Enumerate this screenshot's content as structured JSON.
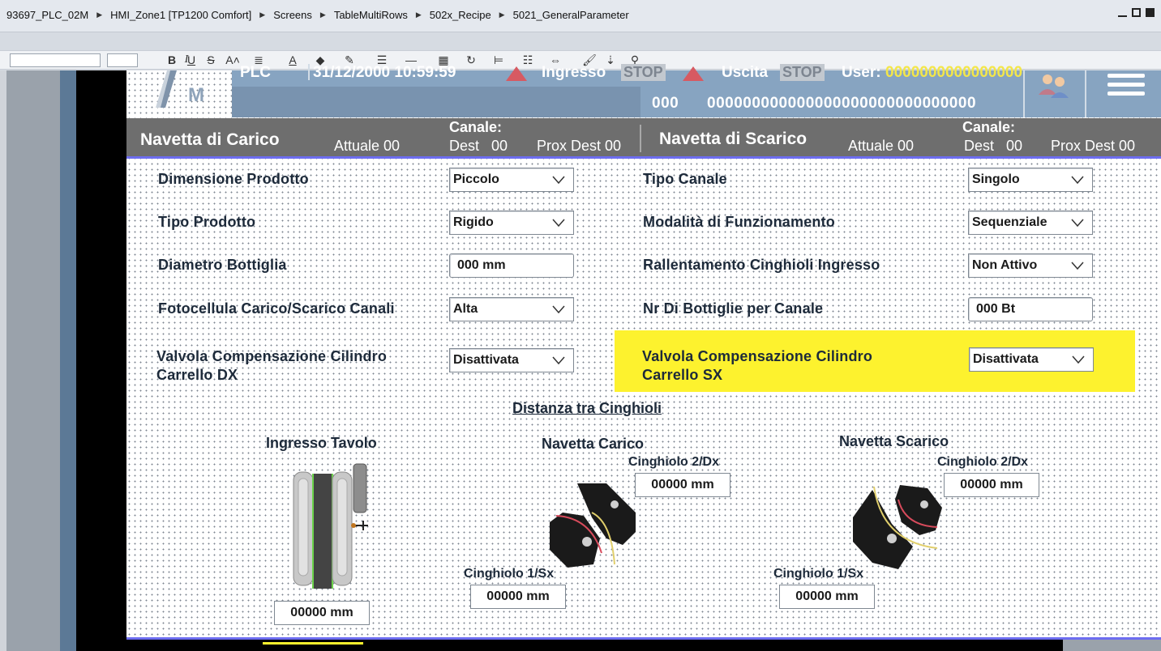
{
  "breadcrumb": {
    "items": [
      "93697_PLC_02M",
      "HMI_Zone1 [TP1200 Comfort]",
      "Screens",
      "TableMultiRows",
      "502x_Recipe",
      "5021_GeneralParameter"
    ]
  },
  "toolbar": {
    "bold": "B",
    "italic": "I",
    "underline": "U",
    "strike": "S"
  },
  "header": {
    "plc_label": "PLC",
    "datetime": "31/12/2000 10:59:59",
    "ingresso_label": "Ingresso",
    "ingresso_stop": "STOP",
    "uscita_label": "Uscita",
    "uscita_stop": "STOP",
    "user_label": "User:",
    "user_value": "0000000000000000",
    "code_short": "000",
    "code_long": "000000000000000000000000000000"
  },
  "band": {
    "carico_title": "Navetta di Carico",
    "carico_attuale": "Attuale 00",
    "carico_canale": "Canale:",
    "carico_dest": "Dest",
    "carico_dest_val": "00",
    "carico_prox": "Prox Dest 00",
    "scarico_title": "Navetta di Scarico",
    "scarico_attuale": "Attuale 00",
    "scarico_canale": "Canale:",
    "scarico_dest": "Dest",
    "scarico_dest_val": "00",
    "scarico_prox": "Prox Dest 00"
  },
  "form": {
    "dimensione_label": "Dimensione Prodotto",
    "dimensione_value": "Piccolo",
    "tipo_prodotto_label": "Tipo Prodotto",
    "tipo_prodotto_value": "Rigido",
    "diametro_label": "Diametro Bottiglia",
    "diametro_value": "000 mm",
    "fotocellula_label": "Fotocellula Carico/Scarico Canali",
    "fotocellula_value": "Alta",
    "valvola_dx_label_1": "Valvola Compensazione Cilindro",
    "valvola_dx_label_2": "Carrello DX",
    "valvola_dx_value": "Disattivata",
    "tipo_canale_label": "Tipo Canale",
    "tipo_canale_value": "Singolo",
    "modalita_label": "Modalità di Funzionamento",
    "modalita_value": "Sequenziale",
    "rallentamento_label": "Rallentamento Cinghioli Ingresso",
    "rallentamento_value": "Non Attivo",
    "nr_bottiglie_label": "Nr Di Bottiglie per Canale",
    "nr_bottiglie_value": "000 Bt",
    "valvola_sx_label_1": "Valvola Compensazione Cilindro",
    "valvola_sx_label_2": "Carrello SX",
    "valvola_sx_value": "Disattivata"
  },
  "distanza": {
    "title": "Distanza tra Cinghioli",
    "ingresso_title": "Ingresso Tavolo",
    "ingresso_value": "00000 mm",
    "carico_title": "Navetta Carico",
    "carico_2dx_label": "Cinghiolo 2/Dx",
    "carico_2dx_value": "00000 mm",
    "carico_1sx_label": "Cinghiolo 1/Sx",
    "carico_1sx_value": "00000 mm",
    "scarico_title": "Navetta Scarico",
    "scarico_2dx_label": "Cinghiolo 2/Dx",
    "scarico_2dx_value": "00000 mm",
    "scarico_1sx_label": "Cinghiolo 1/Sx",
    "scarico_1sx_value": "00000 mm"
  },
  "icons": [
    "users-icon",
    "menu-icon",
    "warning-icon",
    "dropdown-arrow-icon",
    "conveyor-icon",
    "shuttle-icon"
  ],
  "colors": {
    "header_blue": "#87a4c1",
    "band_grey": "#6e6e6e",
    "highlight_yellow": "#fdf22e",
    "accent_blue": "#6d6df0"
  }
}
